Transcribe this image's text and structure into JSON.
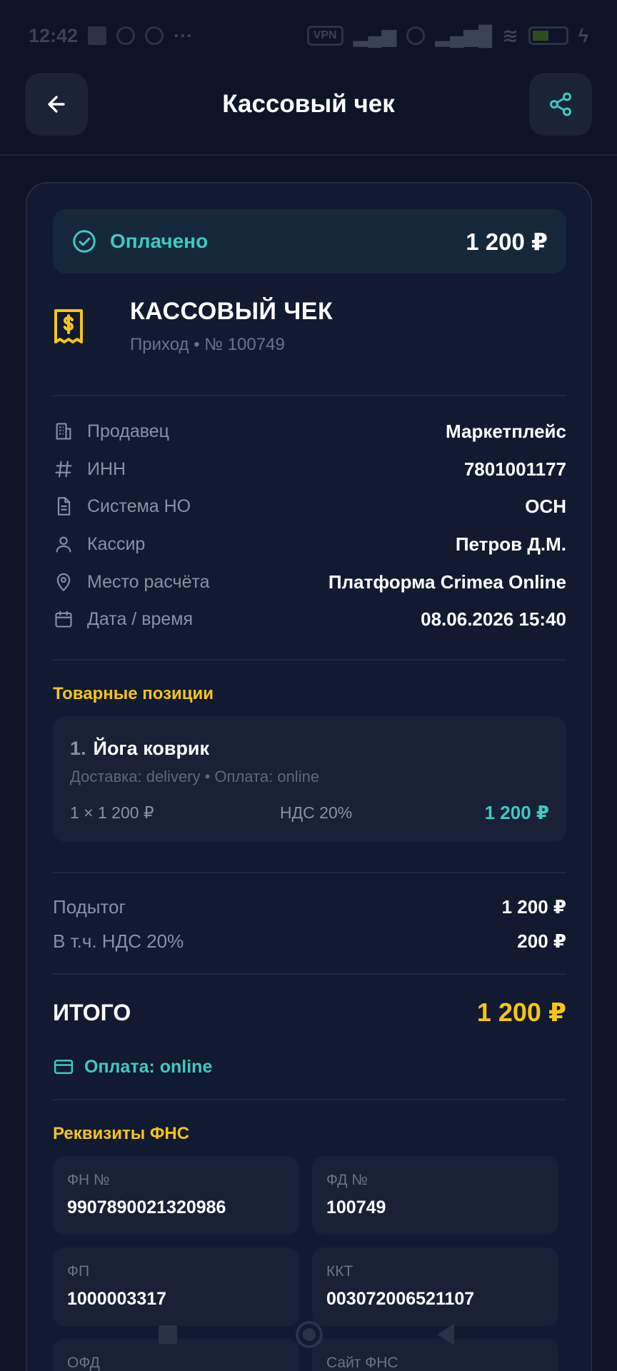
{
  "status_bar": {
    "time": "12:42",
    "network": "VPN",
    "battery": "5"
  },
  "header": {
    "title": "Кассовый чек"
  },
  "status": {
    "label": "Оплачено",
    "amount": "1 200 ₽"
  },
  "receipt": {
    "title": "КАССОВЫЙ ЧЕК",
    "subtitle": "Приход • № 100749"
  },
  "info": [
    {
      "icon": "building-icon",
      "label": "Продавец",
      "value": "Маркетплейс"
    },
    {
      "icon": "hash-icon",
      "label": "ИНН",
      "value": "7801001177"
    },
    {
      "icon": "document-icon",
      "label": "Система НО",
      "value": "ОСН"
    },
    {
      "icon": "user-icon",
      "label": "Кассир",
      "value": "Петров Д.М."
    },
    {
      "icon": "location-pin-icon",
      "label": "Место расчёта",
      "value": "Платформа Crimea Online"
    },
    {
      "icon": "calendar-icon",
      "label": "Дата / время",
      "value": "08.06.2026 15:40"
    }
  ],
  "items_title": "Товарные позиции",
  "items": [
    {
      "number": "1.",
      "name": "Йога коврик",
      "meta": "Доставка: delivery • Оплата: online",
      "qty": "1 × 1 200 ₽",
      "vat": "НДС 20%",
      "sum": "1 200 ₽"
    }
  ],
  "totals": [
    {
      "label": "Подытог",
      "value": "1 200 ₽"
    },
    {
      "label": "В т.ч. НДС 20%",
      "value": "200 ₽"
    }
  ],
  "grand_total": {
    "label": "ИТОГО",
    "value": "1 200 ₽"
  },
  "payment": {
    "label": "Оплата: online"
  },
  "fns_title": "Реквизиты ФНС",
  "fns": [
    {
      "label": "ФН №",
      "value": "9907890021320986"
    },
    {
      "label": "ФД №",
      "value": "100749"
    },
    {
      "label": "ФП",
      "value": "1000003317"
    },
    {
      "label": "ККТ",
      "value": "003072006521107"
    },
    {
      "label": "ОФД",
      "value": ""
    },
    {
      "label": "Сайт ФНС",
      "value": ""
    }
  ],
  "colors": {
    "accent_teal": "#3fc9c0",
    "accent_yellow": "#f5c518",
    "background": "#0d1428",
    "card": "#111a30"
  }
}
